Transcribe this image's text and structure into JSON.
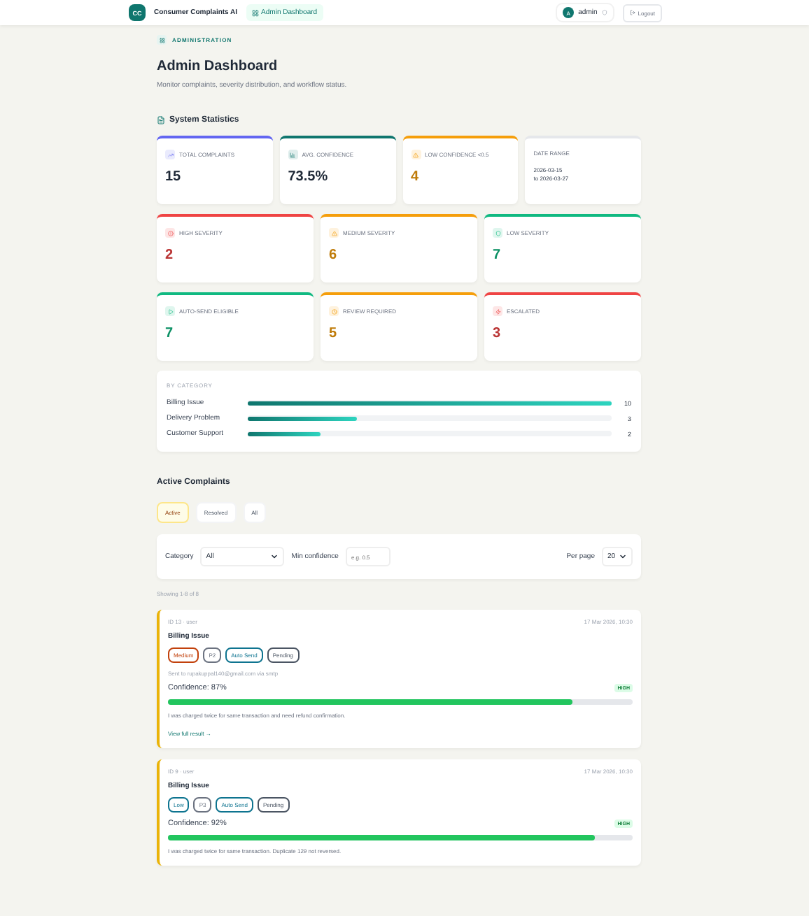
{
  "header": {
    "logo": "CC",
    "brand": "Consumer Complaints AI",
    "nav": [
      {
        "label": "Admin Dashboard",
        "selected": true
      }
    ],
    "user": {
      "avatar": "A",
      "name": "admin"
    },
    "logout": "Logout"
  },
  "section_badge": "ADMINISTRATION",
  "title": "Admin Dashboard",
  "subtitle": "Monitor complaints, severity distribution, and workflow status.",
  "stats_heading": "System Statistics",
  "stat_rows": [
    [
      {
        "kind": "metric",
        "label": "TOTAL COMPLAINTS",
        "value": "15",
        "color": "#6366f1",
        "accent_value": false
      },
      {
        "kind": "metric",
        "label": "AVG. CONFIDENCE",
        "value": "73.5%",
        "color": "#0f766e",
        "accent_value": false
      },
      {
        "kind": "metric",
        "label": "LOW CONFIDENCE <0.5",
        "value": "4",
        "color": "#f59e0b",
        "accent_value": true
      },
      {
        "kind": "range",
        "label": "DATE RANGE",
        "lines": [
          "2026-03-15",
          "to 2026-03-27"
        ],
        "color": "#e5e7eb"
      }
    ],
    [
      {
        "kind": "metric",
        "label": "HIGH SEVERITY",
        "value": "2",
        "color": "#ef4444",
        "accent_value": true
      },
      {
        "kind": "metric",
        "label": "MEDIUM SEVERITY",
        "value": "6",
        "color": "#f59e0b",
        "accent_value": true
      },
      {
        "kind": "metric",
        "label": "LOW SEVERITY",
        "value": "7",
        "color": "#10b981",
        "accent_value": true
      }
    ],
    [
      {
        "kind": "metric",
        "label": "AUTO-SEND ELIGIBLE",
        "value": "7",
        "color": "#10b981",
        "accent_value": true
      },
      {
        "kind": "metric",
        "label": "REVIEW REQUIRED",
        "value": "5",
        "color": "#f59e0b",
        "accent_value": true
      },
      {
        "kind": "metric",
        "label": "ESCALATED",
        "value": "3",
        "color": "#ef4444",
        "accent_value": true
      }
    ]
  ],
  "by_category": {
    "heading": "BY CATEGORY",
    "items": [
      {
        "label": "Billing Issue",
        "level": 1,
        "count": "10"
      },
      {
        "label": "Delivery Problem",
        "level": 0.3,
        "count": "3"
      },
      {
        "label": "Customer Support",
        "level": 0.2,
        "count": "2"
      }
    ]
  },
  "complaints_heading": "Active Complaints",
  "tabs": [
    {
      "label": "Active",
      "selected": true
    },
    {
      "label": "Resolved",
      "selected": false
    },
    {
      "label": "All",
      "selected": false
    }
  ],
  "filters": {
    "category_label": "Category",
    "category_value": "All",
    "min_conf_label": "Min confidence",
    "min_conf_placeholder": "e.g. 0.5",
    "per_page_label": "Per page",
    "per_page_value": "20"
  },
  "showing": "Showing 1-8 of 8",
  "complaints": [
    {
      "meta": "ID 13 · user",
      "date": "17 Mar 2026, 10:30",
      "title": "Billing Issue",
      "tags": [
        {
          "label": "Medium",
          "color": "#c2410c"
        },
        {
          "label": "P2",
          "color": "#6b7280"
        },
        {
          "label": "Auto Send",
          "color": "#0e7490"
        },
        {
          "label": "Pending",
          "color": "#4b5563"
        }
      ],
      "sent": "Sent to rupakuppal140@gmail.com via smtp",
      "confidence": "Confidence: 87%",
      "level": 0.87,
      "badge": "HIGH",
      "text": "I was charged twice for same transaction and need refund confirmation.",
      "link": "View full result →"
    },
    {
      "meta": "ID 9 · user",
      "date": "17 Mar 2026, 10:30",
      "title": "Billing Issue",
      "tags": [
        {
          "label": "Low",
          "color": "#0e7490"
        },
        {
          "label": "P3",
          "color": "#6b7280"
        },
        {
          "label": "Auto Send",
          "color": "#0e7490"
        },
        {
          "label": "Pending",
          "color": "#4b5563"
        }
      ],
      "confidence": "Confidence: 92%",
      "level": 0.92,
      "badge": "HIGH",
      "text": "I was charged twice for same transaction. Duplicate 129 not reversed."
    }
  ]
}
